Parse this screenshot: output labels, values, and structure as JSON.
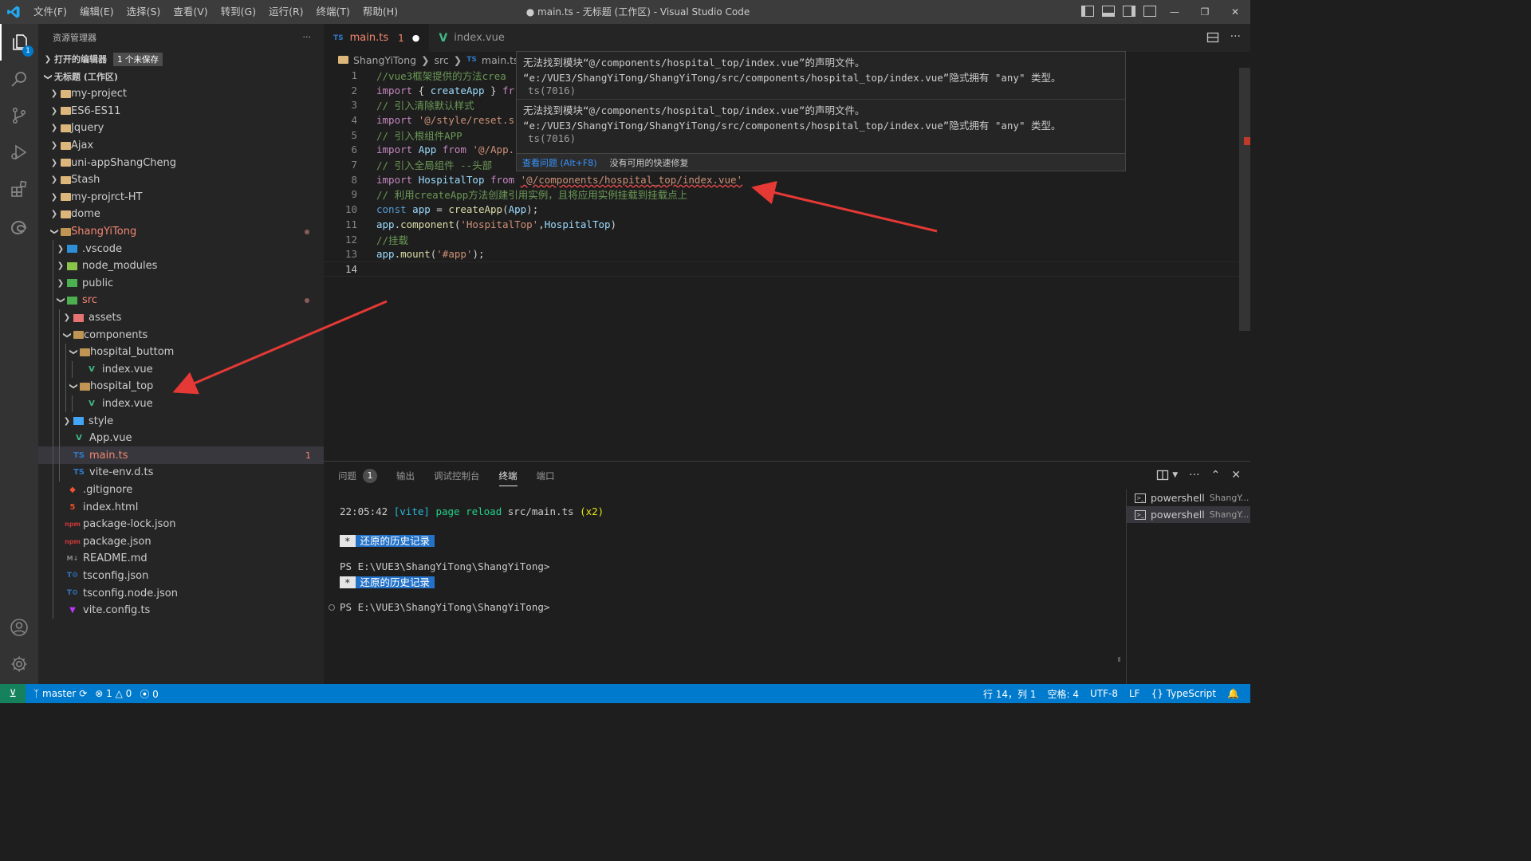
{
  "titlebar": {
    "menu": [
      "文件(F)",
      "编辑(E)",
      "选择(S)",
      "查看(V)",
      "转到(G)",
      "运行(R)",
      "终端(T)",
      "帮助(H)"
    ],
    "title": "● main.ts - 无标题 (工作区) - Visual Studio Code"
  },
  "activity_bar": {
    "items": [
      "files-icon",
      "search-icon",
      "source-control-icon",
      "run-debug-icon",
      "extensions-icon",
      "edge-devtools-icon"
    ],
    "bottom": [
      "account-icon",
      "settings-gear-icon"
    ],
    "explorer_badge": "1"
  },
  "sidebar": {
    "title": "资源管理器",
    "more": "···",
    "open_editors": "打开的编辑器",
    "unsaved": "1 个未保存",
    "workspace": "无标题 (工作区)",
    "tree": [
      {
        "label": "my-project",
        "depth": 0,
        "kind": "folder",
        "open": false
      },
      {
        "label": "ES6-ES11",
        "depth": 0,
        "kind": "folder",
        "open": false
      },
      {
        "label": "Jquery",
        "depth": 0,
        "kind": "folder",
        "open": false
      },
      {
        "label": "Ajax",
        "depth": 0,
        "kind": "folder",
        "open": false
      },
      {
        "label": "uni-appShangCheng",
        "depth": 0,
        "kind": "folder",
        "open": false
      },
      {
        "label": "Stash",
        "depth": 0,
        "kind": "folder",
        "open": false
      },
      {
        "label": "my-projrct-HT",
        "depth": 0,
        "kind": "folder",
        "open": false
      },
      {
        "label": "dome",
        "depth": 0,
        "kind": "folder",
        "open": false
      },
      {
        "label": "ShangYiTong",
        "depth": 0,
        "kind": "folder",
        "open": true,
        "error": true,
        "dot": true
      },
      {
        "label": ".vscode",
        "depth": 1,
        "kind": "vscode",
        "open": false
      },
      {
        "label": "node_modules",
        "depth": 1,
        "kind": "node",
        "open": false
      },
      {
        "label": "public",
        "depth": 1,
        "kind": "public",
        "open": false
      },
      {
        "label": "src",
        "depth": 1,
        "kind": "src",
        "open": true,
        "error": true,
        "dot": true
      },
      {
        "label": "assets",
        "depth": 2,
        "kind": "assets",
        "open": false
      },
      {
        "label": "components",
        "depth": 2,
        "kind": "folder",
        "open": true
      },
      {
        "label": "hospital_buttom",
        "depth": 3,
        "kind": "folder",
        "open": true
      },
      {
        "label": "index.vue",
        "depth": 4,
        "kind": "vue"
      },
      {
        "label": "hospital_top",
        "depth": 3,
        "kind": "folder",
        "open": true
      },
      {
        "label": "index.vue",
        "depth": 4,
        "kind": "vue"
      },
      {
        "label": "style",
        "depth": 2,
        "kind": "style",
        "open": false
      },
      {
        "label": "App.vue",
        "depth": 2,
        "kind": "vue"
      },
      {
        "label": "main.ts",
        "depth": 2,
        "kind": "ts",
        "error": true,
        "selected": true,
        "count": "1"
      },
      {
        "label": "vite-env.d.ts",
        "depth": 2,
        "kind": "ts"
      },
      {
        "label": ".gitignore",
        "depth": 1,
        "kind": "git"
      },
      {
        "label": "index.html",
        "depth": 1,
        "kind": "html"
      },
      {
        "label": "package-lock.json",
        "depth": 1,
        "kind": "npm"
      },
      {
        "label": "package.json",
        "depth": 1,
        "kind": "npm"
      },
      {
        "label": "README.md",
        "depth": 1,
        "kind": "md"
      },
      {
        "label": "tsconfig.json",
        "depth": 1,
        "kind": "tsconfig"
      },
      {
        "label": "tsconfig.node.json",
        "depth": 1,
        "kind": "tsconfig"
      },
      {
        "label": "vite.config.ts",
        "depth": 1,
        "kind": "vite"
      }
    ]
  },
  "tabs": [
    {
      "icon": "TS",
      "label": "main.ts",
      "problems": "1",
      "dirty": "●",
      "active": true
    },
    {
      "icon": "V",
      "label": "index.vue",
      "active": false
    }
  ],
  "breadcrumb": [
    "ShangYiTong",
    "src",
    "main.ts",
    "..."
  ],
  "editor": {
    "lines": [
      {
        "n": "1",
        "tokens": [
          [
            "c-com",
            "//vue3框架提供的方法crea"
          ]
        ]
      },
      {
        "n": "2",
        "tokens": [
          [
            "c-kw",
            "import"
          ],
          [
            "c-p",
            " { "
          ],
          [
            "c-var",
            "createApp"
          ],
          [
            "c-p",
            " } "
          ],
          [
            "c-kw",
            "fr"
          ]
        ]
      },
      {
        "n": "3",
        "tokens": [
          [
            "c-com",
            "// 引入清除默认样式"
          ]
        ]
      },
      {
        "n": "4",
        "tokens": [
          [
            "c-kw",
            "import"
          ],
          [
            "c-p",
            " "
          ],
          [
            "c-str",
            "'@/style/reset.s"
          ]
        ]
      },
      {
        "n": "5",
        "tokens": [
          [
            "c-com",
            "// 引入根组件APP"
          ]
        ]
      },
      {
        "n": "6",
        "tokens": [
          [
            "c-kw",
            "import"
          ],
          [
            "c-p",
            " "
          ],
          [
            "c-var",
            "App"
          ],
          [
            "c-p",
            " "
          ],
          [
            "c-kw",
            "from"
          ],
          [
            "c-p",
            " "
          ],
          [
            "c-str",
            "'@/App."
          ]
        ]
      },
      {
        "n": "7",
        "tokens": [
          [
            "c-com",
            "// 引入全局组件 --头部 "
          ]
        ]
      },
      {
        "n": "8",
        "tokens": [
          [
            "c-kw",
            "import"
          ],
          [
            "c-p",
            " "
          ],
          [
            "c-var",
            "HospitalTop"
          ],
          [
            "c-p",
            " "
          ],
          [
            "c-kw",
            "from"
          ],
          [
            "c-p",
            " "
          ],
          [
            "c-str squiggle",
            "'@/components/hospital_top/index.vue'"
          ]
        ]
      },
      {
        "n": "9",
        "tokens": [
          [
            "c-com",
            "// 利用createApp方法创建引用实例，且将应用实例挂载到挂载点上"
          ]
        ]
      },
      {
        "n": "10",
        "tokens": [
          [
            "c-dec",
            "const"
          ],
          [
            "c-p",
            " "
          ],
          [
            "c-var",
            "app"
          ],
          [
            "c-p",
            " = "
          ],
          [
            "c-fn",
            "createApp"
          ],
          [
            "c-p",
            "("
          ],
          [
            "c-var",
            "App"
          ],
          [
            "c-p",
            ");"
          ]
        ]
      },
      {
        "n": "11",
        "tokens": [
          [
            "c-var",
            "app"
          ],
          [
            "c-p",
            "."
          ],
          [
            "c-fn",
            "component"
          ],
          [
            "c-p",
            "("
          ],
          [
            "c-str",
            "'HospitalTop'"
          ],
          [
            "c-p",
            ","
          ],
          [
            "c-var",
            "HospitalTop"
          ],
          [
            "c-p",
            ")"
          ]
        ]
      },
      {
        "n": "12",
        "tokens": [
          [
            "c-com",
            "//挂载"
          ]
        ]
      },
      {
        "n": "13",
        "tokens": [
          [
            "c-var",
            "app"
          ],
          [
            "c-p",
            "."
          ],
          [
            "c-fn",
            "mount"
          ],
          [
            "c-p",
            "("
          ],
          [
            "c-str",
            "'#app'"
          ],
          [
            "c-p",
            ");"
          ]
        ]
      },
      {
        "n": "14",
        "tokens": []
      }
    ],
    "current_line": "14"
  },
  "hover": {
    "problems": [
      {
        "line1": "无法找到模块“@/components/hospital_top/index.vue”的声明文件。",
        "line2": "“e:/VUE3/ShangYiTong/ShangYiTong/src/components/hospital_top/index.vue”隐式拥有 \"any\" 类型。",
        "code": "ts(7016)"
      },
      {
        "line1": "无法找到模块“@/components/hospital_top/index.vue”的声明文件。",
        "line2": "“e:/VUE3/ShangYiTong/ShangYiTong/src/components/hospital_top/index.vue”隐式拥有 \"any\" 类型。",
        "code": "ts(7016)"
      }
    ],
    "view_problem": "查看问题 (Alt+F8)",
    "no_fix": "没有可用的快速修复"
  },
  "panel": {
    "tabs": [
      {
        "label": "问题",
        "badge": "1"
      },
      {
        "label": "输出"
      },
      {
        "label": "调试控制台"
      },
      {
        "label": "终端",
        "active": true
      },
      {
        "label": "端口"
      }
    ],
    "terminal": {
      "time": "22:05:42",
      "vite": "[vite]",
      "msg": "page reload",
      "file": "src/main.ts",
      "times": "(x2)",
      "star": "*",
      "restored": "还原的历史记录",
      "prompt": "PS E:\\VUE3\\ShangYiTong\\ShangYiTong>"
    },
    "instances": [
      {
        "label": "powershell",
        "sub": "ShangY..."
      },
      {
        "label": "powershell",
        "sub": "ShangY..."
      }
    ]
  },
  "statusbar": {
    "branch": "master",
    "errors": "1",
    "warnings": "0",
    "ports": "0",
    "position": "行 14，列 1",
    "spaces": "空格: 4",
    "encoding": "UTF-8",
    "eol": "LF",
    "language": "TypeScript"
  },
  "colors": {
    "accent": "#007acc",
    "error": "#f48771",
    "annotation_arrow": "#e53935"
  }
}
